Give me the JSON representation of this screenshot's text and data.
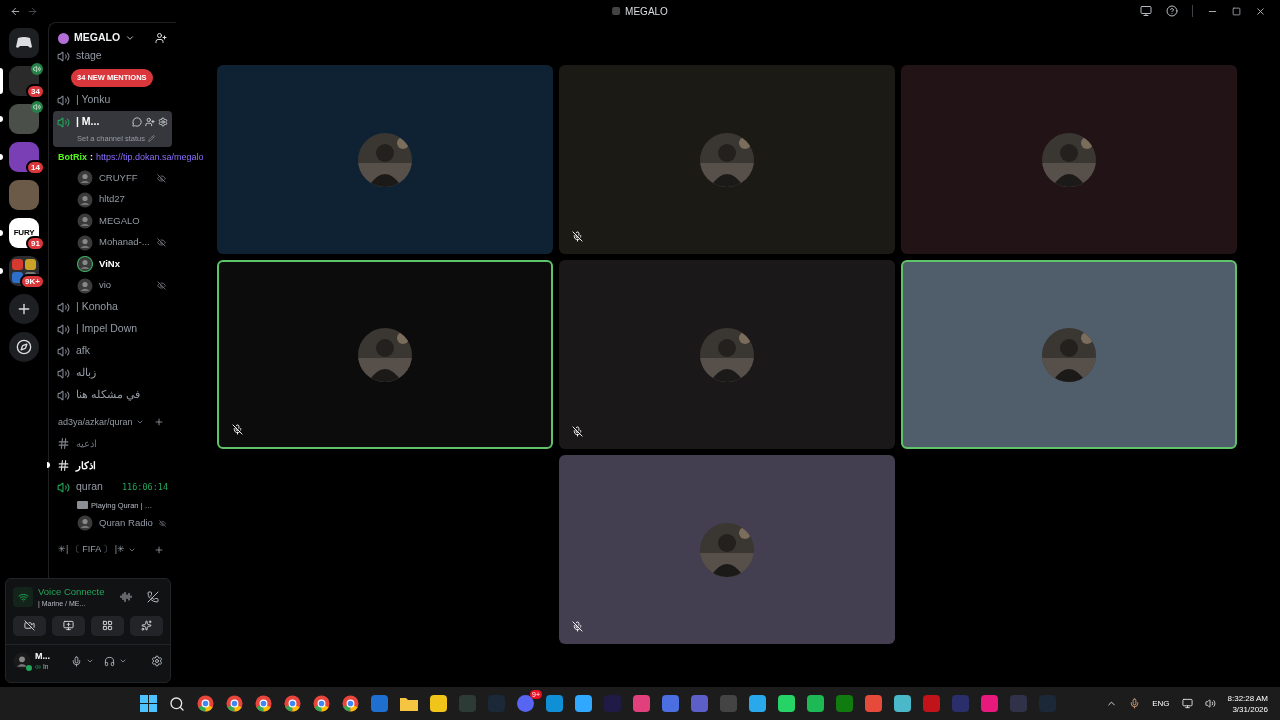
{
  "window": {
    "title": "MEGALO"
  },
  "servers": [
    {
      "kind": "home",
      "selected": false,
      "unread": false
    },
    {
      "kind": "server",
      "badge": "34",
      "voice": true,
      "selected": true,
      "unread": false,
      "color": "#2a2a2a"
    },
    {
      "kind": "server",
      "voice": true,
      "selected": false,
      "unread": true,
      "color": "#4a4f4a"
    },
    {
      "kind": "server",
      "badge": "14",
      "voice": false,
      "selected": false,
      "unread": true,
      "color": "#7b3fb5"
    },
    {
      "kind": "server",
      "voice": false,
      "selected": false,
      "unread": false,
      "color": "#6b5a48"
    },
    {
      "kind": "server",
      "label": "FURY",
      "badge": "91",
      "voice": false,
      "selected": false,
      "unread": true,
      "color": "#ffffff"
    },
    {
      "kind": "folder",
      "badge": "9K+",
      "selected": false,
      "unread": true
    },
    {
      "kind": "add"
    },
    {
      "kind": "discover"
    }
  ],
  "server_header": {
    "name": "MEGALO"
  },
  "mentions_pill": "34 NEW MENTIONS",
  "channels": [
    {
      "kind": "voice",
      "name": "stage",
      "selected": false,
      "active": false
    },
    {
      "kind": "voice",
      "name": "| Yonku",
      "selected": false,
      "active": false
    },
    {
      "kind": "voice",
      "name": "| M...",
      "selected": true,
      "active": true,
      "status": "Set a channel status"
    },
    {
      "kind": "overlay",
      "name": "BotRix",
      "separator": ":",
      "link": "https://tip.dokan.sa/megalo"
    },
    {
      "kind": "member",
      "name": "CRUYFF",
      "speaking": false,
      "muted": true
    },
    {
      "kind": "member",
      "name": "hltd27",
      "speaking": false,
      "muted": false
    },
    {
      "kind": "member",
      "name": "MEGALO",
      "speaking": false,
      "muted": false
    },
    {
      "kind": "member",
      "name": "Mohanad-...",
      "speaking": false,
      "muted": true
    },
    {
      "kind": "member",
      "name": "ViNx",
      "speaking": true,
      "muted": false
    },
    {
      "kind": "member",
      "name": "vio",
      "speaking": false,
      "muted": true
    },
    {
      "kind": "voice",
      "name": "| Konoha",
      "selected": false,
      "active": false
    },
    {
      "kind": "voice",
      "name": "| Impel Down",
      "selected": false,
      "active": false
    },
    {
      "kind": "voice",
      "name": "afk",
      "selected": false,
      "active": false
    },
    {
      "kind": "voice",
      "name": "زباله",
      "selected": false,
      "active": false
    },
    {
      "kind": "voice",
      "name": "في مشكله هنا",
      "selected": false,
      "active": false
    },
    {
      "kind": "category",
      "name": "ad3ya/azkar/quran"
    },
    {
      "kind": "text",
      "name": "ادعيه",
      "selected": false,
      "unread": false
    },
    {
      "kind": "text",
      "name": "اذكار",
      "selected": false,
      "unread": true
    },
    {
      "kind": "voice",
      "name": "quran",
      "selected": false,
      "active": true,
      "timer": "116:06:14",
      "activity": "Playing Quran | …"
    },
    {
      "kind": "member",
      "name": "Quran Radio",
      "speaking": false,
      "muted": true
    },
    {
      "kind": "category",
      "name": "✳| 〔 FIFA 〕 |✳"
    }
  ],
  "voice_panel": {
    "title": "Voice Connecte",
    "channel": "| Marine / ME..."
  },
  "user_panel": {
    "name": "M...",
    "status": "In"
  },
  "tiles": [
    {
      "color": "#0e2234",
      "speaking": false,
      "muted": false
    },
    {
      "color": "#1c1a14",
      "speaking": false,
      "muted": true
    },
    {
      "color": "#221416",
      "speaking": false,
      "muted": false
    },
    {
      "color": "#0c0c0c",
      "speaking": true,
      "muted": true
    },
    {
      "color": "#1b1819",
      "speaking": false,
      "muted": true
    },
    {
      "color": "#4f5e6a",
      "speaking": true,
      "muted": false
    },
    {
      "color": "#443e51",
      "speaking": false,
      "muted": true
    }
  ],
  "taskbar": {
    "discord_badge": "9+",
    "language": "ENG",
    "time": "8:32:28 AM",
    "date": "3/31/2026"
  }
}
